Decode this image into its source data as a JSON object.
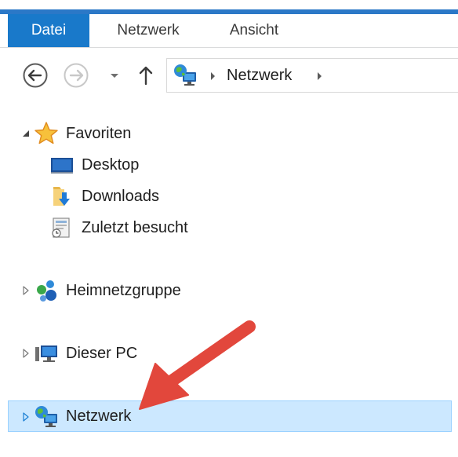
{
  "ribbon": {
    "tabs": [
      {
        "label": "Datei",
        "active": true
      },
      {
        "label": "Netzwerk",
        "active": false
      },
      {
        "label": "Ansicht",
        "active": false
      }
    ]
  },
  "navigation": {
    "back_icon": "back-arrow-icon",
    "forward_icon": "forward-arrow-icon",
    "recent_icon": "chevron-down-icon",
    "up_icon": "up-arrow-icon",
    "address": {
      "location_icon": "network-icon",
      "crumb": "Netzwerk"
    }
  },
  "tree": {
    "favorites": {
      "label": "Favoriten",
      "icon": "star-icon",
      "expanded": true,
      "children": [
        {
          "label": "Desktop",
          "icon": "desktop-icon"
        },
        {
          "label": "Downloads",
          "icon": "downloads-folder-icon"
        },
        {
          "label": "Zuletzt besucht",
          "icon": "recent-places-icon"
        }
      ]
    },
    "homegroup": {
      "label": "Heimnetzgruppe",
      "icon": "homegroup-icon",
      "expanded": false
    },
    "this_pc": {
      "label": "Dieser PC",
      "icon": "computer-icon",
      "expanded": false
    },
    "network": {
      "label": "Netzwerk",
      "icon": "network-icon",
      "expanded": false,
      "selected": true
    }
  },
  "colors": {
    "accent": "#1979ca",
    "selection_bg": "#cce8ff",
    "selection_border": "#99d1ff",
    "annotation_arrow": "#e2473c"
  }
}
